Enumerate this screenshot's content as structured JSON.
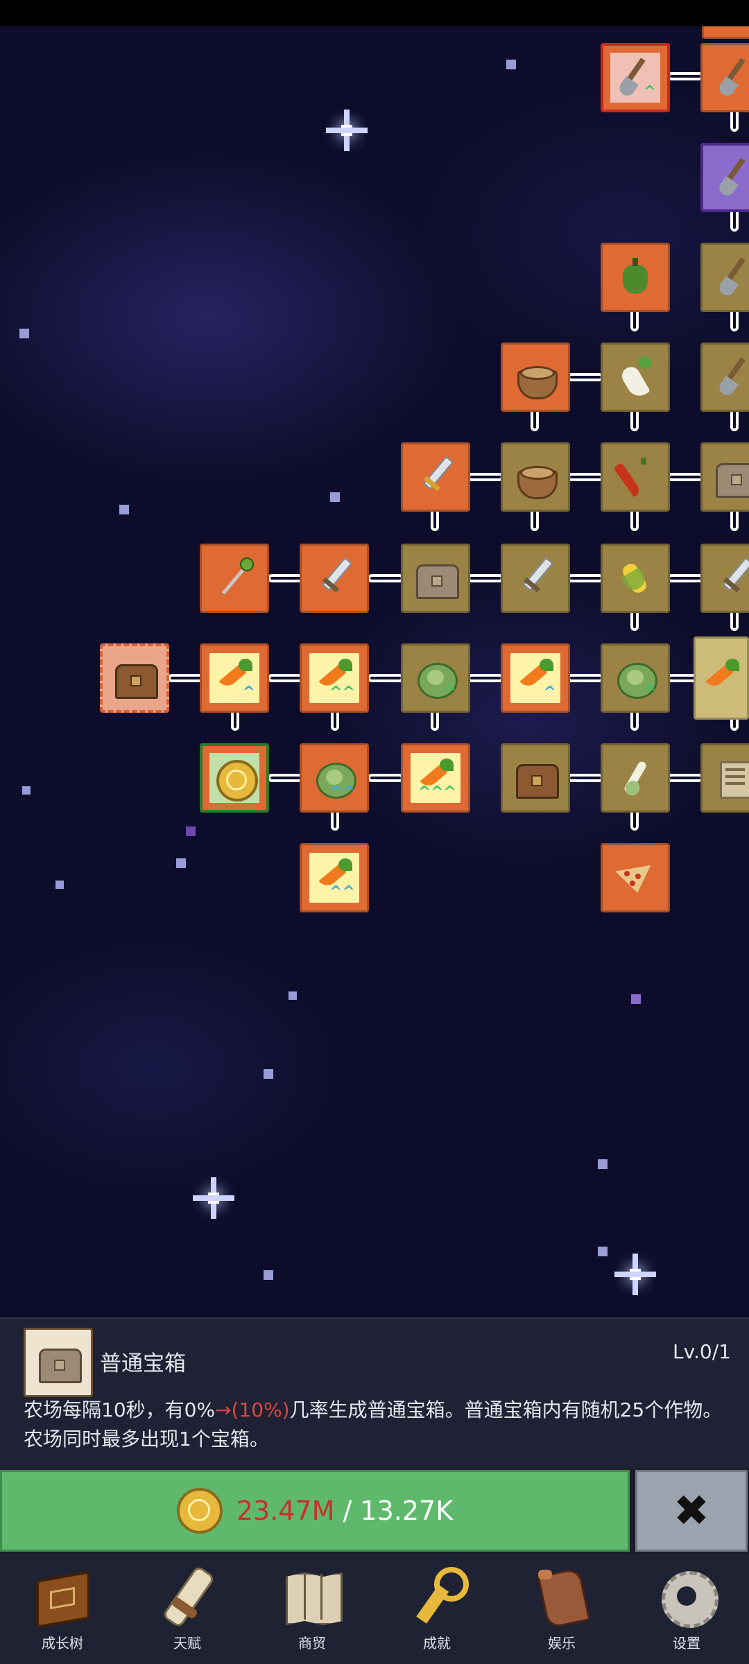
{
  "skill_tree": {
    "nodes": [
      {
        "id": "shovel-1",
        "icon": "shovel-icon"
      },
      {
        "id": "shovel-2",
        "icon": "shovel-icon"
      },
      {
        "id": "shovel-purple",
        "icon": "shovel-icon"
      },
      {
        "id": "pepper",
        "icon": "bell-pepper-icon"
      },
      {
        "id": "shovel-3",
        "icon": "shovel-icon"
      },
      {
        "id": "bowl-1",
        "icon": "bowl-icon"
      },
      {
        "id": "radish",
        "icon": "radish-icon"
      },
      {
        "id": "shovel-4",
        "icon": "shovel-icon"
      },
      {
        "id": "golden-sword",
        "icon": "sword-icon"
      },
      {
        "id": "bowl-2",
        "icon": "bowl-icon"
      },
      {
        "id": "chili",
        "icon": "chili-icon"
      },
      {
        "id": "chest-edge",
        "icon": "chest-icon"
      },
      {
        "id": "staff",
        "icon": "staff-icon"
      },
      {
        "id": "sword-1",
        "icon": "sword-icon"
      },
      {
        "id": "chest-stone",
        "icon": "chest-icon"
      },
      {
        "id": "sword-2",
        "icon": "sword-icon"
      },
      {
        "id": "corn",
        "icon": "corn-icon"
      },
      {
        "id": "sword-3",
        "icon": "sword-icon"
      },
      {
        "id": "chest-selected",
        "icon": "chest-icon",
        "selected": true
      },
      {
        "id": "carrot-1",
        "icon": "carrot-icon"
      },
      {
        "id": "carrot-2",
        "icon": "carrot-icon"
      },
      {
        "id": "cabbage-1",
        "icon": "cabbage-icon"
      },
      {
        "id": "carrot-3",
        "icon": "carrot-icon"
      },
      {
        "id": "cabbage-2",
        "icon": "cabbage-icon"
      },
      {
        "id": "carrot-4",
        "icon": "carrot-icon"
      },
      {
        "id": "coin",
        "icon": "coin-icon"
      },
      {
        "id": "cabbage-3",
        "icon": "cabbage-icon"
      },
      {
        "id": "carrot-5",
        "icon": "carrot-icon"
      },
      {
        "id": "chest-wood",
        "icon": "chest-icon"
      },
      {
        "id": "spring-onion",
        "icon": "spring-onion-icon"
      },
      {
        "id": "map-edge",
        "icon": "map-icon"
      },
      {
        "id": "carrot-6",
        "icon": "carrot-icon"
      },
      {
        "id": "pizza",
        "icon": "pizza-icon"
      }
    ]
  },
  "info_panel": {
    "icon": "chest-icon",
    "title": "普通宝箱",
    "level": "Lv.0/1",
    "desc_before": "农场每隔10秒，有0%",
    "desc_highlight": "→(10%)",
    "desc_after": "几率生成普通宝箱。普通宝箱内有随机25个作物。农场同时最多出现1个宝箱。",
    "highlight_color": "#e0463a"
  },
  "buy": {
    "icon": "coin-icon",
    "have": "23.47M",
    "separator": " / ",
    "need": "13.27K",
    "have_color": "#c72f2a",
    "button_color": "#5fb96d"
  },
  "close": {
    "icon": "close-x-icon",
    "label": "✖"
  },
  "nav": {
    "items": [
      {
        "label": "成长树",
        "icon": "book-icon"
      },
      {
        "label": "天赋",
        "icon": "scroll-icon"
      },
      {
        "label": "商贸",
        "icon": "map-icon"
      },
      {
        "label": "成就",
        "icon": "key-icon"
      },
      {
        "label": "娱乐",
        "icon": "flag-icon"
      },
      {
        "label": "设置",
        "icon": "gear-icon"
      }
    ]
  }
}
